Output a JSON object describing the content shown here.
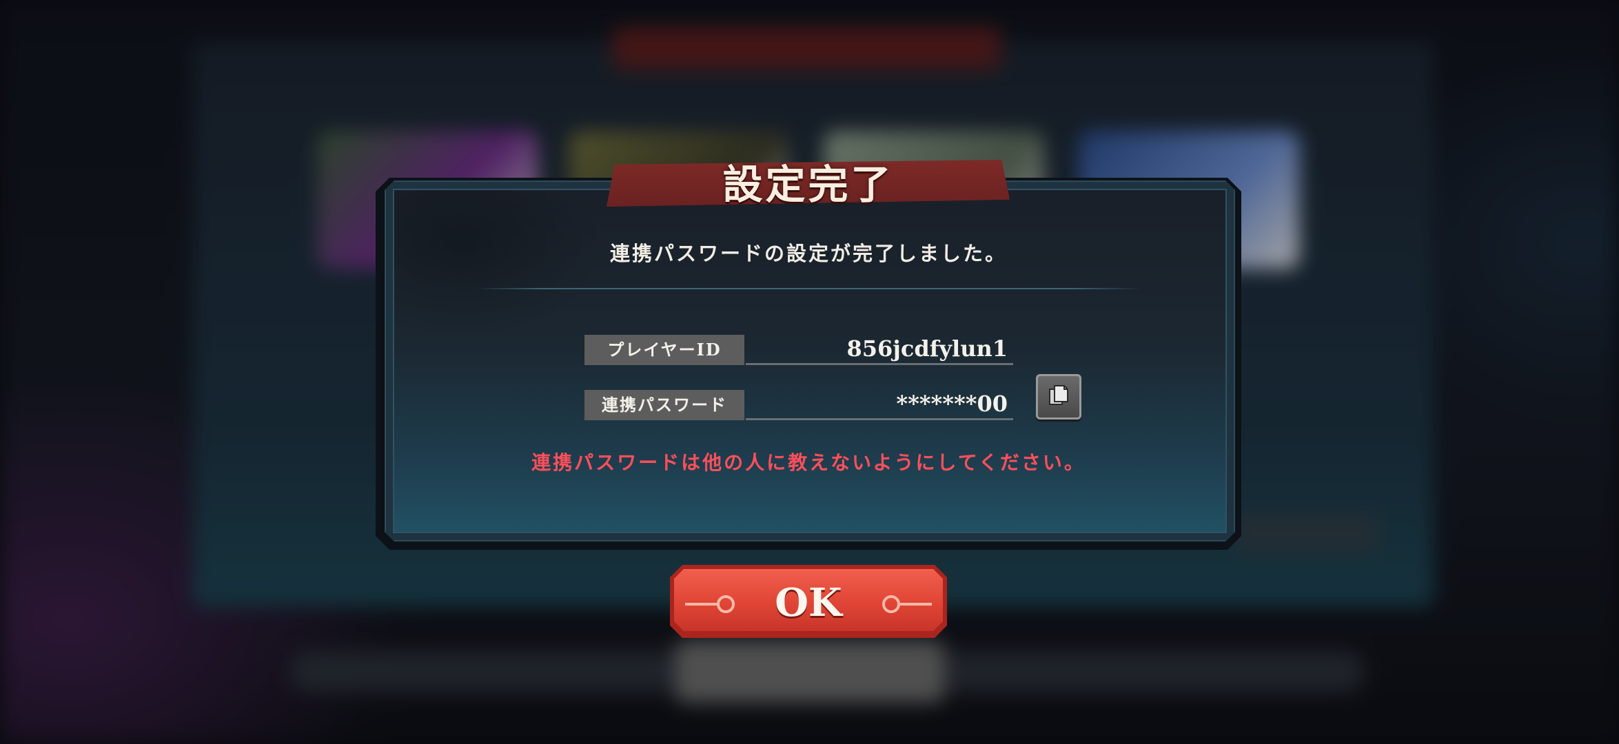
{
  "dialog": {
    "title": "設定完了",
    "message": "連携パスワードの設定が完了しました。",
    "player_id": {
      "label": "プレイヤーID",
      "value": "856jcdfylun1"
    },
    "password": {
      "label": "連携パスワード",
      "value": "*******00"
    },
    "copy_icon": "copy-icon",
    "warning": "連携パスワードは他の人に教えないようにしてください。",
    "warning_color": "#ff4f5a"
  },
  "ok_button": {
    "label": "OK",
    "color": "#e04535"
  }
}
